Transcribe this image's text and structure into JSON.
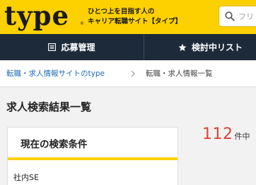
{
  "header": {
    "logo": "type",
    "logo_mark": "®",
    "tagline_line1": "ひとつ上を目指す人の",
    "tagline_line2": "キャリア転職サイト【タイプ】",
    "search": {
      "placeholder": "フリ"
    }
  },
  "nav": {
    "apply_label": "応募管理",
    "saved_label": "検討中リスト"
  },
  "breadcrumb": {
    "home": "転職・求人情報サイトのtype",
    "current": "転職・求人情報一覧"
  },
  "page": {
    "title": "求人検索結果一覧"
  },
  "conditions": {
    "title": "現在の検索条件",
    "value": "社内SE"
  },
  "results": {
    "count": "112",
    "unit": "件中"
  },
  "colors": {
    "brand_yellow": "#fdd000",
    "nav_dark": "#1c2a3a",
    "link_blue": "#1f6bb8",
    "count_red": "#e0413a"
  }
}
